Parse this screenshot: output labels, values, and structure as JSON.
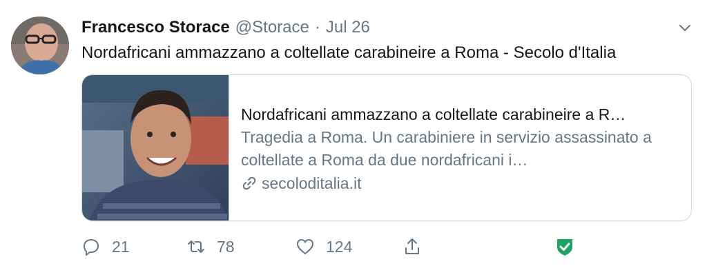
{
  "tweet": {
    "author_name": "Francesco Storace",
    "handle": "@Storace",
    "separator": "·",
    "date": "Jul 26",
    "text": "Nordafricani ammazzano a coltellate carabineire a Roma - Secolo d'Italia"
  },
  "card": {
    "title": "Nordafricani ammazzano a coltellate carabineire a R…",
    "description": "Tragedia a Roma. Un carabiniere in servizio assassinato a coltellate a Roma da due nordafricani i…",
    "domain": "secoloditalia.it"
  },
  "actions": {
    "replies": "21",
    "retweets": "78",
    "likes": "124"
  },
  "colors": {
    "text": "#14171a",
    "muted": "#657786",
    "border": "#ccd6dd",
    "verified_shield": "#1ea363"
  },
  "icons": [
    "chevron-down-icon",
    "link-icon",
    "reply-icon",
    "retweet-icon",
    "like-icon",
    "share-icon",
    "shield-check-icon"
  ]
}
